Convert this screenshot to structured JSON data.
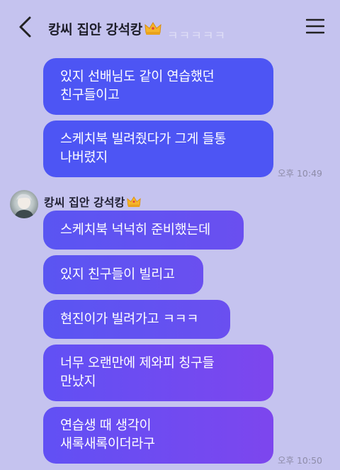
{
  "header": {
    "title": "캉씨 집안 강석캉",
    "title_suffix_icon": "crown-emoji-icon",
    "back_icon": "chevron-left-icon",
    "menu_icon": "hamburger-menu-icon"
  },
  "ghost": {
    "text": "ㅋㅋㅋㅋㅋ"
  },
  "outgoing": {
    "messages": [
      {
        "line1": "있지 선배님도 같이 연습했던",
        "line2": "친구들이고"
      },
      {
        "line1": "스케치북 빌려줬다가 그게 들통",
        "line2": "나버렸지"
      }
    ],
    "time": "오후 10:49"
  },
  "incoming": {
    "sender_name": "캉씨 집안 강석캉",
    "messages": [
      {
        "line1": "스케치북 넉넉히 준비했는데"
      },
      {
        "line1": "있지 친구들이 빌리고"
      },
      {
        "line1": "현진이가 빌려가고 ㅋㅋㅋ"
      },
      {
        "line1": "너무 오랜만에 제와피 칭구들",
        "line2": "만났지"
      },
      {
        "line1": "연습생 때 생각이",
        "line2": "새록새록이더라구"
      }
    ],
    "time": "오후 10:50"
  },
  "colors": {
    "background": "#c5c3ef",
    "bubble_blue": "#4d55f4",
    "bubble_purple": "#7d46ee"
  }
}
